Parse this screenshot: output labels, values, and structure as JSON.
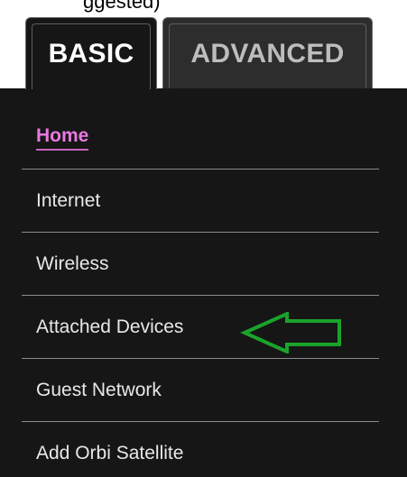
{
  "caption": {
    "fragment": "ggested)"
  },
  "tabs": [
    {
      "label": "BASIC",
      "selected": true
    },
    {
      "label": "ADVANCED",
      "selected": false
    }
  ],
  "menu": {
    "items": [
      {
        "label": "Home",
        "active": true
      },
      {
        "label": "Internet",
        "active": false
      },
      {
        "label": "Wireless",
        "active": false
      },
      {
        "label": "Attached Devices",
        "active": false
      },
      {
        "label": "Guest Network",
        "active": false
      },
      {
        "label": "Add Orbi Satellite",
        "active": false
      }
    ]
  },
  "annotation": {
    "icon": "arrow-left-outline-icon",
    "color": "#1aa32b",
    "points_to": "Attached Devices"
  },
  "colors": {
    "panel_bg": "#161616",
    "active_item": "#e879e0",
    "menu_text": "#e8e8e8",
    "divider": "#8a8a8a"
  }
}
